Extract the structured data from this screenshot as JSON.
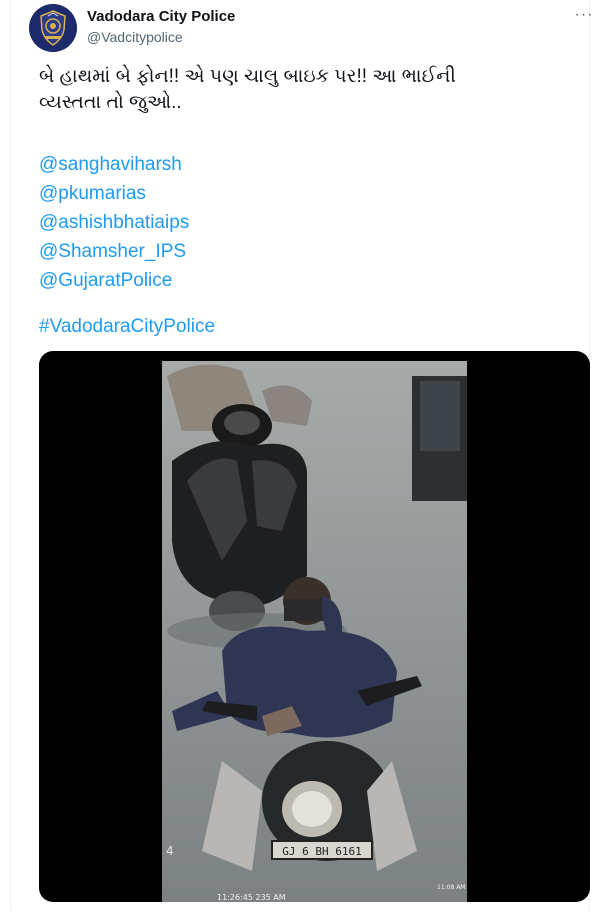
{
  "account": {
    "display_name": "Vadodara City Police",
    "handle": "@Vadcitypolice"
  },
  "menu": {
    "more_icon": "more-horizontal-icon",
    "more_label": "···"
  },
  "tweet": {
    "text_line_1": "બે હાથમાં બે ફોન!! એ પણ ચાલુ બાઇક પર!! આ ભાઈની",
    "text_line_2": "વ્યસ્તતા તો જુઓ..",
    "mentions": [
      "@sanghaviharsh",
      "@pkumarias",
      "@ashishbhatiaips",
      "@Shamsher_IPS",
      "@GujaratPolice"
    ],
    "hashtag": "#VadodaraCityPolice"
  },
  "video": {
    "plate_text": "GJ 6 BH 6161",
    "timestamp": "11:26:45 235 AM",
    "corner_label": "11:08 AM",
    "frame_number": "4"
  },
  "colors": {
    "link": "#1d9bf0",
    "text": "#0f1419",
    "muted": "#536471",
    "media_bg": "#000000"
  }
}
